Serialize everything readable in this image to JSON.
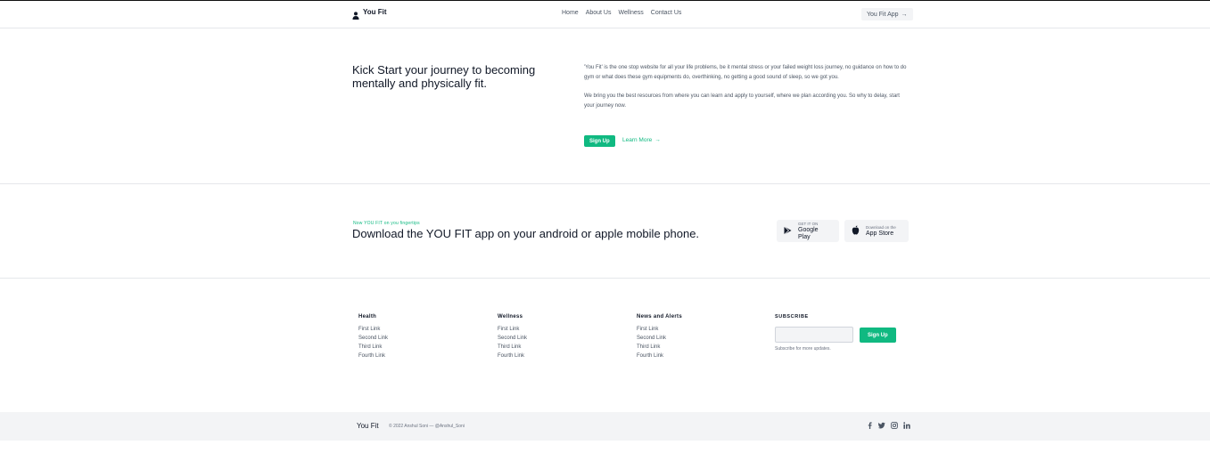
{
  "header": {
    "brand": "You Fit",
    "nav": [
      "Home",
      "About Us",
      "Wellness",
      "Contact Us"
    ],
    "app_button": "You Fit App",
    "arrow": "→"
  },
  "hero": {
    "title": "Kick Start your journey to becoming mentally and physically fit.",
    "para1": "'You Fit' is the one stop website for all your life problems, be it mental stress or your failed weight loss journey, no guidance on how to do gym or what does these gym equipments do, overthinking, no getting a good sound of sleep, so we got you.",
    "para2": "We bring you the best resources from where you can learn and apply to yourself, where we plan according you. So why to delay, start your journey now.",
    "signup": "Sign Up",
    "learn_more": "Learn More",
    "arrow": "→"
  },
  "app_section": {
    "eyebrow": "Now YOU FIT on you fingertips",
    "title": "Download the YOU FIT app on your android or apple mobile phone.",
    "google": {
      "small": "GET IT ON",
      "big": "Google Play"
    },
    "apple": {
      "small": "Download on the",
      "big": "App Store"
    }
  },
  "footer": {
    "columns": [
      {
        "title": "Health",
        "links": [
          "First Link",
          "Second Link",
          "Third Link",
          "Fourth Link"
        ]
      },
      {
        "title": "Wellness",
        "links": [
          "First Link",
          "Second Link",
          "Third Link",
          "Fourth Link"
        ]
      },
      {
        "title": "News and Alerts",
        "links": [
          "First Link",
          "Second Link",
          "Third Link",
          "Fourth Link"
        ]
      }
    ],
    "subscribe": {
      "title": "SUBSCRIBE",
      "input_value": "",
      "button": "Sign Up",
      "note": "Subscribe for more updates."
    }
  },
  "bottom_bar": {
    "brand": "You Fit",
    "copyright": "© 2022 Anshul Soni — @Anshul_Soni",
    "socials": [
      "facebook-icon",
      "twitter-icon",
      "instagram-icon",
      "linkedin-icon"
    ]
  },
  "colors": {
    "accent": "#10b981",
    "text": "#111827",
    "muted": "#4b5563",
    "surface": "#f3f4f6"
  }
}
